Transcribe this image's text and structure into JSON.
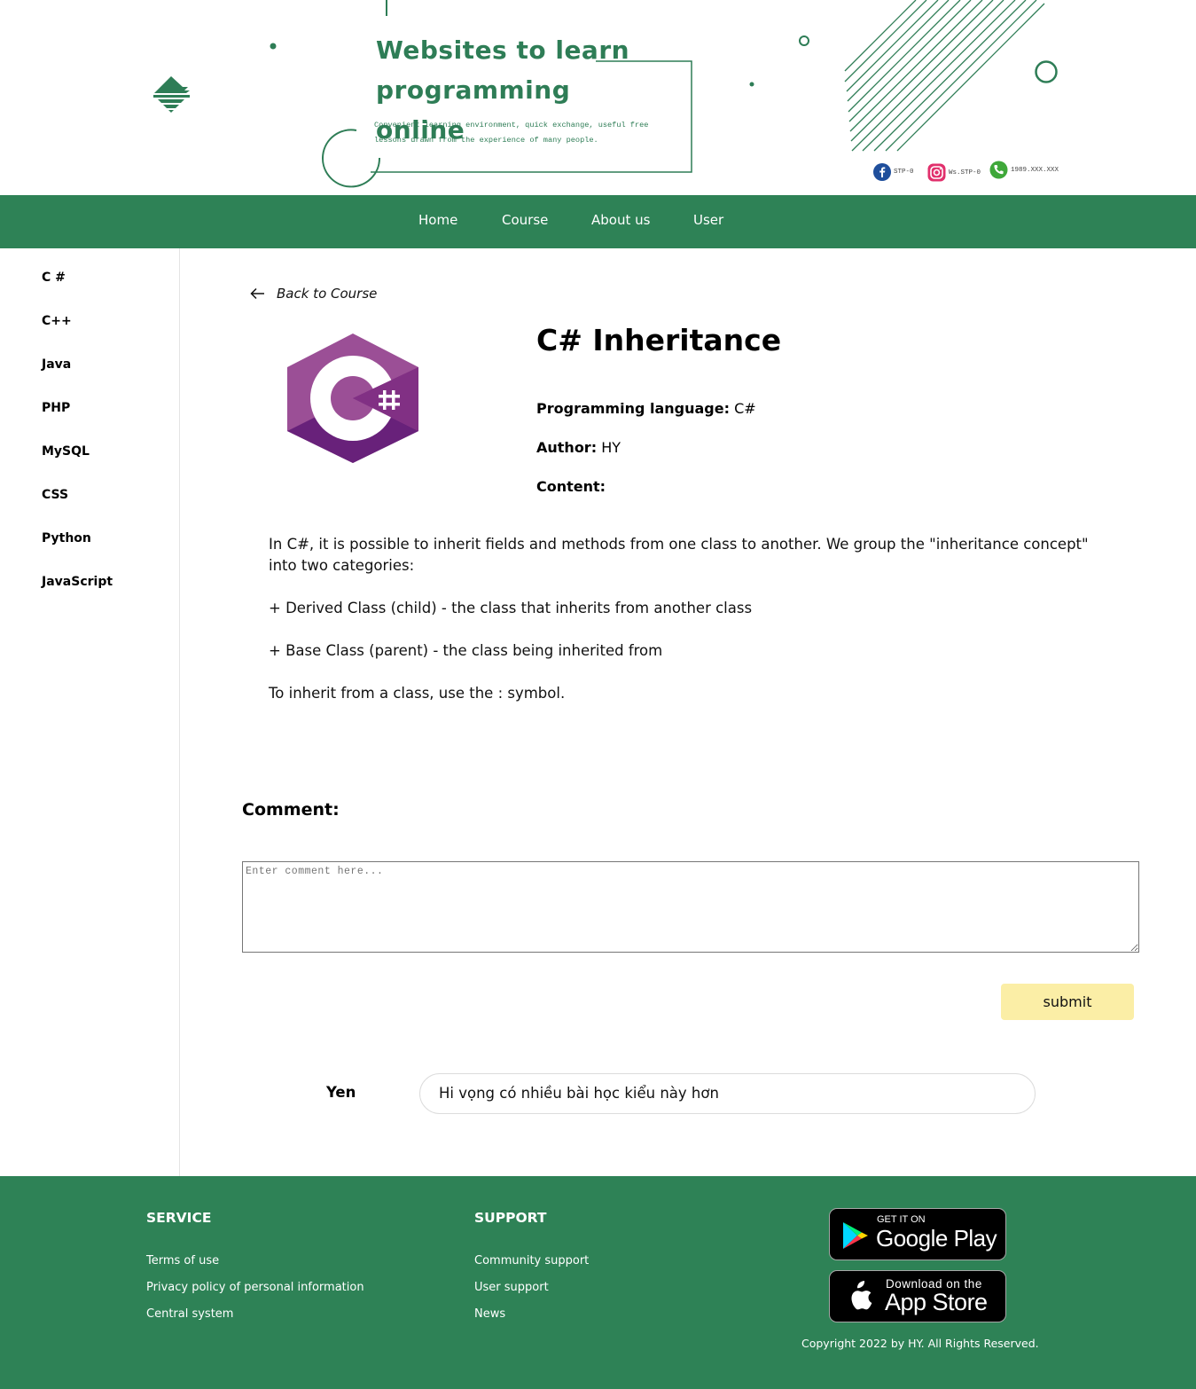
{
  "header": {
    "title_line1": "Websites to learn",
    "title_line2": "programming online",
    "subtitle_line1": "Convenient learning environment, quick exchange, useful free",
    "subtitle_line2": "lessons drawn from the experience of many people.",
    "contacts": [
      {
        "icon": "facebook-icon",
        "label": "STP-0"
      },
      {
        "icon": "instagram-icon",
        "label": "Ws.STP-0"
      },
      {
        "icon": "phone-icon",
        "label": "1989.XXX.XXX"
      }
    ]
  },
  "nav": {
    "items": [
      {
        "label": "Home"
      },
      {
        "label": "Course"
      },
      {
        "label": "About us"
      },
      {
        "label": "User"
      }
    ]
  },
  "sidebar": {
    "items": [
      {
        "label": "C #"
      },
      {
        "label": "C++"
      },
      {
        "label": "Java"
      },
      {
        "label": "PHP"
      },
      {
        "label": "MySQL"
      },
      {
        "label": "CSS"
      },
      {
        "label": "Python"
      },
      {
        "label": "JavaScript"
      }
    ]
  },
  "course": {
    "back_label": "Back to Course",
    "logo_icon": "csharp-logo-icon",
    "title": "C# Inheritance",
    "language_label": "Programming language:",
    "language_value": "C#",
    "author_label": "Author:",
    "author_value": "HY",
    "content_label": "Content:",
    "content_paragraphs": [
      "In C#, it is possible to inherit fields and methods from one class to another. We group the \"inheritance concept\" into two categories:",
      "+ Derived Class (child) - the class that inherits from another class",
      "+ Base Class (parent) - the class being inherited from",
      "To inherit from a class, use the : symbol."
    ]
  },
  "comments": {
    "heading": "Comment:",
    "input_placeholder": "Enter comment here...",
    "input_value": "",
    "submit_label": "submit",
    "list": [
      {
        "user": "Yen",
        "text": "Hi vọng có nhiều bài học kiểu này hơn"
      }
    ]
  },
  "footer": {
    "service_heading": "SERVICE",
    "service_links": [
      "Terms of use",
      "Privacy policy of personal information",
      "Central system"
    ],
    "support_heading": "SUPPORT",
    "support_links": [
      "Community support",
      "User support",
      "News"
    ],
    "google_play_small": "GET IT ON",
    "google_play_big": "Google Play",
    "app_store_small": "Download on the",
    "app_store_big": "App Store",
    "copyright": "Copyright 2022 by HY. All Rights Reserved."
  },
  "colors": {
    "brand_green": "#2e8256",
    "submit_yellow": "#fbeea6",
    "csharp_purple": "#9b4f96"
  }
}
